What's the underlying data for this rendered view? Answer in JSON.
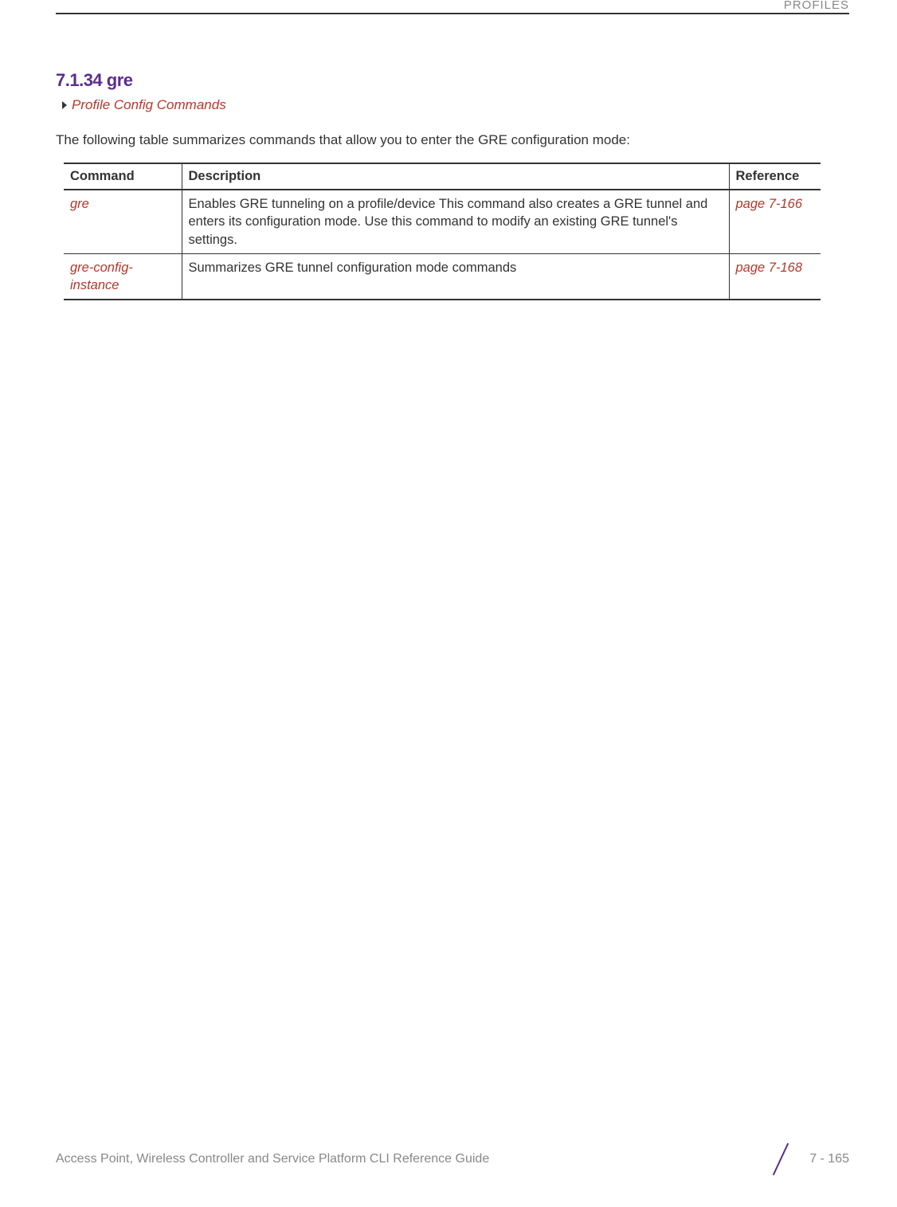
{
  "header": {
    "label": "PROFILES"
  },
  "section": {
    "number": "7.1.34 gre",
    "breadcrumb": "Profile Config Commands",
    "intro": "The following table summarizes commands that allow you to enter the GRE configuration mode:"
  },
  "table": {
    "headers": {
      "command": "Command",
      "description": "Description",
      "reference": "Reference"
    },
    "rows": [
      {
        "command": "gre",
        "description": "Enables GRE tunneling on a profile/device This command also creates a GRE tunnel and enters its configuration mode. Use this command to modify an existing GRE tunnel's settings.",
        "reference": "page 7-166"
      },
      {
        "command": "gre-config-instance",
        "description": "Summarizes GRE tunnel configuration mode commands",
        "reference": "page 7-168"
      }
    ]
  },
  "footer": {
    "title": "Access Point, Wireless Controller and Service Platform CLI Reference Guide",
    "page": "7 - 165"
  }
}
